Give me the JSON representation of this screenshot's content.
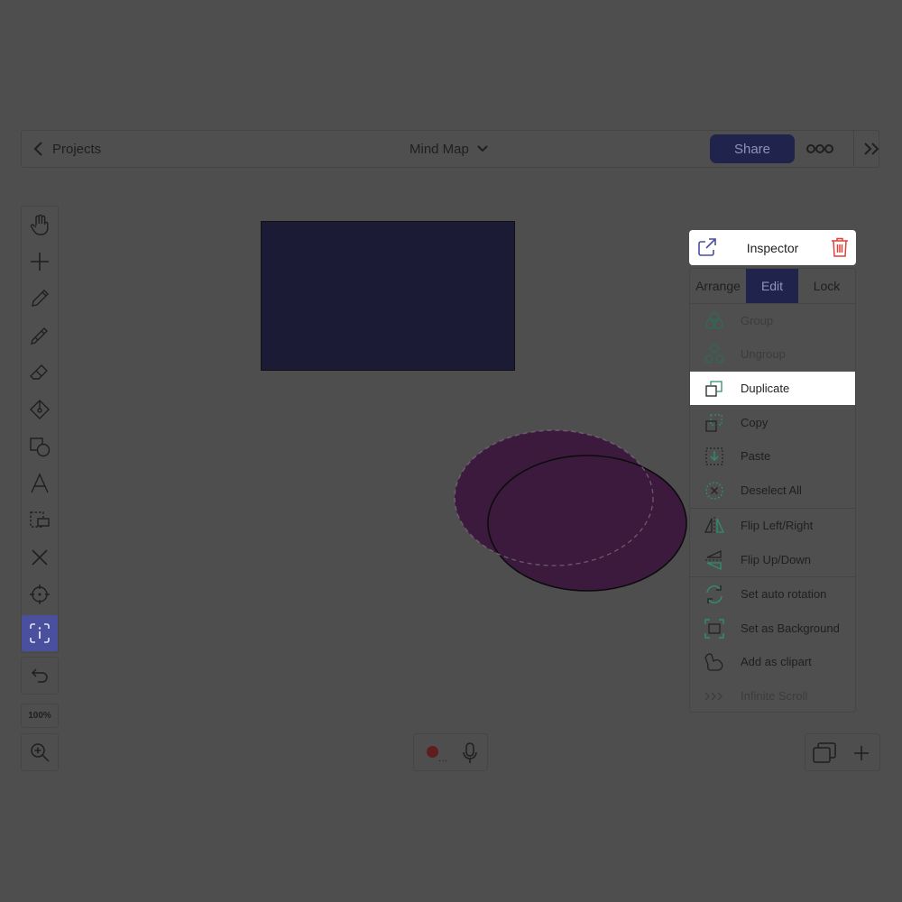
{
  "topbar": {
    "back_label": "Projects",
    "title": "Mind Map",
    "share_label": "Share"
  },
  "toolbar": {
    "tools": [
      "hand-icon",
      "plus-icon",
      "pencil-icon",
      "marker-icon",
      "eraser-icon",
      "fill-icon",
      "shapes-icon",
      "text-icon",
      "select-box-icon",
      "close-icon",
      "target-icon",
      "inspector-select-icon"
    ],
    "active_tool": "inspector-select-icon",
    "zoom_level": "100%"
  },
  "inspector": {
    "title": "Inspector",
    "tabs": [
      {
        "label": "Arrange",
        "active": false
      },
      {
        "label": "Edit",
        "active": true
      },
      {
        "label": "Lock",
        "active": false
      }
    ],
    "menu": [
      {
        "label": "Group",
        "icon": "group-icon",
        "disabled": true
      },
      {
        "label": "Ungroup",
        "icon": "ungroup-icon",
        "disabled": true
      },
      {
        "label": "Duplicate",
        "icon": "duplicate-icon",
        "highlighted": true
      },
      {
        "label": "Copy",
        "icon": "copy-icon"
      },
      {
        "label": "Paste",
        "icon": "paste-icon"
      },
      {
        "label": "Deselect All",
        "icon": "deselect-icon"
      },
      {
        "label": "Flip Left/Right",
        "icon": "flip-horizontal-icon"
      },
      {
        "label": "Flip Up/Down",
        "icon": "flip-vertical-icon"
      },
      {
        "label": "Set auto rotation",
        "icon": "rotation-icon"
      },
      {
        "label": "Set as Background",
        "icon": "background-icon"
      },
      {
        "label": "Add as clipart",
        "icon": "clipart-icon"
      },
      {
        "label": "Infinite Scroll",
        "icon": "chevrons-right-icon",
        "disabled": true
      }
    ]
  },
  "colors": {
    "accent": "#4a4f9e",
    "share_bg": "#20244c",
    "rect_fill": "#1b1b36",
    "ellipse_fill": "#3c1a3e",
    "menu_icon_green": "#2f8f6a",
    "trash_red": "#e0413a"
  }
}
